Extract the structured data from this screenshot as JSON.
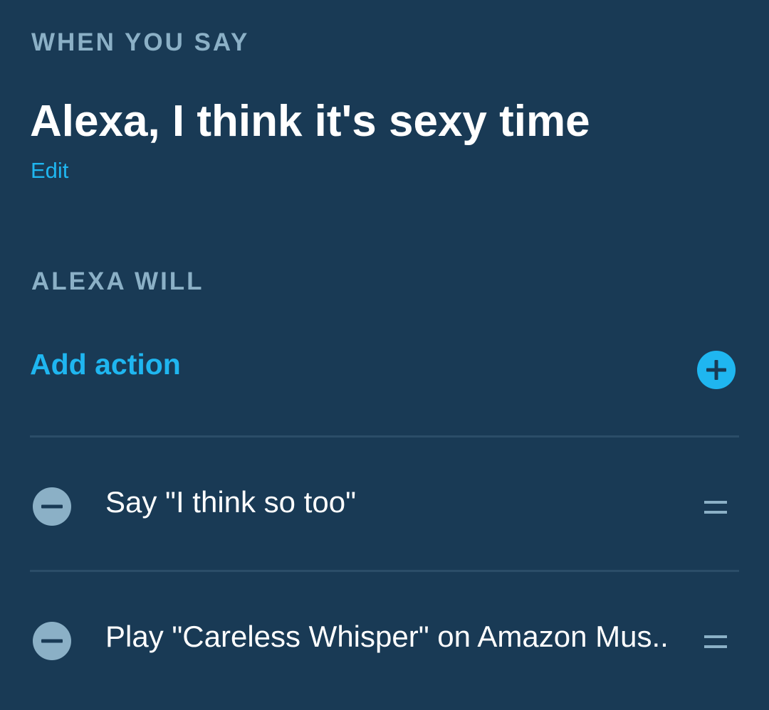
{
  "trigger": {
    "section_label": "WHEN YOU SAY",
    "phrase": "Alexa, I think it's sexy time",
    "edit_label": "Edit"
  },
  "actions_section": {
    "section_label": "ALEXA WILL",
    "add_action_label": "Add action",
    "add_icon": "plus-circle-icon",
    "items": [
      {
        "label": "Say \"I think so too\"",
        "remove_icon": "minus-circle-icon",
        "drag_icon": "drag-handle-icon"
      },
      {
        "label": "Play \"Careless Whisper\" on Amazon Mus..",
        "remove_icon": "minus-circle-icon",
        "drag_icon": "drag-handle-icon"
      }
    ]
  },
  "colors": {
    "background": "#193a55",
    "section_label": "#8bb0c6",
    "accent": "#1fb6f0",
    "text": "#ffffff",
    "remove_icon": "#8bb0c6",
    "divider": "#2b4d68"
  }
}
